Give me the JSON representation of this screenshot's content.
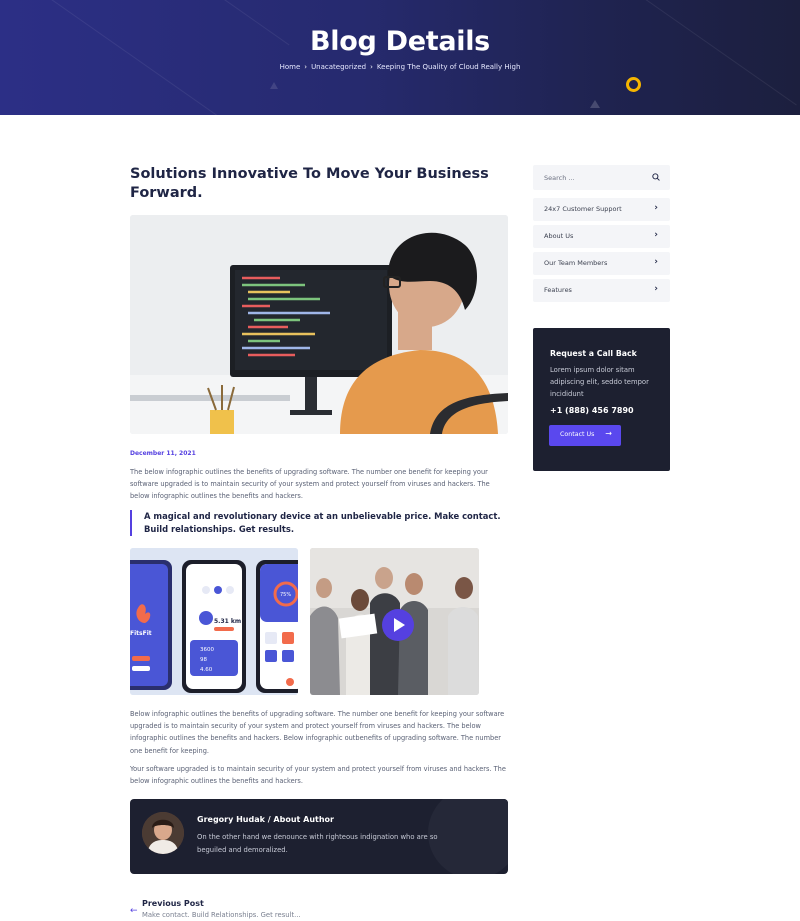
{
  "hero": {
    "title": "Blog Details",
    "breadcrumb": [
      "Home",
      "Unacategorized",
      "Keeping The Quality of Cloud Really High"
    ]
  },
  "post": {
    "title": "Solutions Innovative To Move Your Business Forward.",
    "date": "December 11, 2021",
    "paragraph_1": "The below infographic outlines the benefits of upgrading software. The number one benefit for keeping your software upgraded is to maintain security of your system and protect yourself from viruses and hackers. The below infographic outlines the benefits and hackers.",
    "quote": "A magical and revolutionary device at an unbelievable price. Make contact. Build relationships. Get results.",
    "paragraph_2": "Below infographic outlines the benefits of upgrading software. The number one benefit for keeping your software upgraded is to maintain security of your system and protect yourself from viruses and hackers. The below infographic outlines the benefits and hackers. Below infographic outbenefits of upgrading software. The number one benefit for keeping.",
    "paragraph_3": "Your software upgraded is to maintain security of your system and protect yourself from viruses and hackers. The below infographic outlines the benefits and hackers.",
    "app_image_text": {
      "brand": "FitsFit",
      "distance": "5.31 km",
      "stat_a": "3600",
      "stat_b": "98",
      "stat_c": "4.60",
      "percent": "75%"
    }
  },
  "author": {
    "name": "Gregory Hudak / About Author",
    "bio": "On the other hand we denounce with righteous indignation who are so beguiled and demoralized."
  },
  "navigation": {
    "prev_label": "Previous Post",
    "prev_title": "Make contact. Build Relationships. Get result..."
  },
  "sidebar": {
    "search_placeholder": "Search ...",
    "links": [
      {
        "label": "24x7 Customer Support"
      },
      {
        "label": "About Us"
      },
      {
        "label": "Our Team Members"
      },
      {
        "label": "Features"
      }
    ],
    "callback": {
      "title": "Request a Call Back",
      "text": "Lorem ipsum dolor sitam adipiscing elit, seddo tempor incididunt",
      "phone": "+1 (888) 456 7890",
      "button_label": "Contact Us"
    }
  },
  "colors": {
    "accent": "#5540e0",
    "dark_panel": "#1d2030",
    "hero_start": "#2c2f86",
    "hero_end": "#1c1f3e",
    "ring": "#f5b500"
  }
}
